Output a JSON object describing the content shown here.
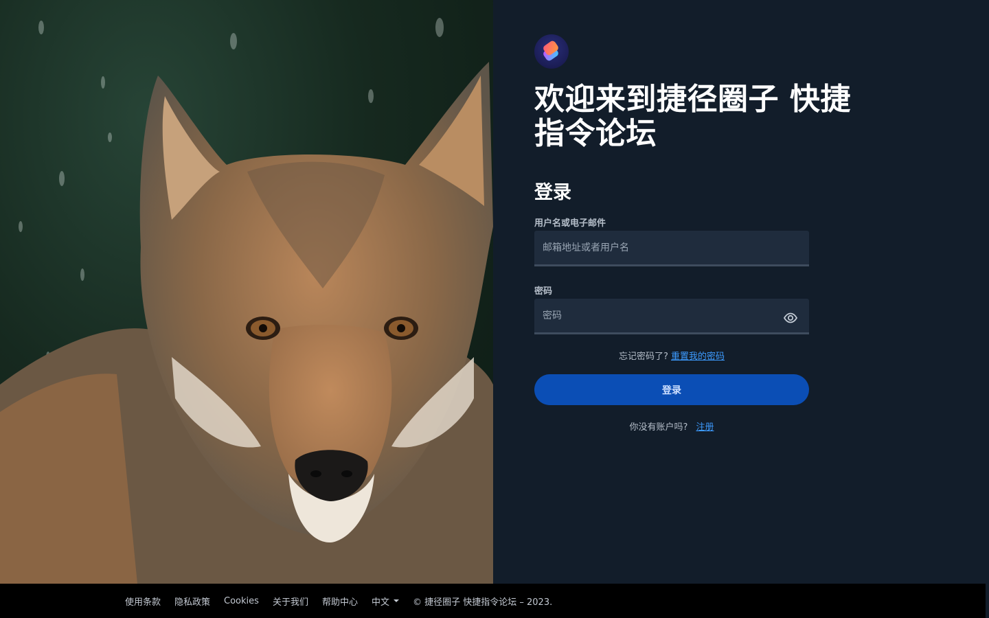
{
  "hero": {
    "image": "wolf-portrait-in-snow"
  },
  "brand": {
    "logo_icon": "shortcuts-logo-icon"
  },
  "headline": "欢迎来到捷径圈子 快捷指令论坛",
  "login": {
    "title": "登录",
    "username_label": "用户名或电子邮件",
    "username_placeholder": "邮箱地址或者用户名",
    "password_label": "密码",
    "password_placeholder": "密码",
    "show_password_icon": "eye-icon",
    "forgot_text": "忘记密码了?",
    "reset_link": "重置我的密码",
    "submit_label": "登录",
    "no_account_text": "你没有账户吗?",
    "register_link": "注册"
  },
  "footer": {
    "links": [
      "使用条款",
      "隐私政策",
      "Cookies",
      "关于我们",
      "帮助中心"
    ],
    "language": "中文",
    "copyright": "© 捷径圈子 快捷指令论坛 – 2023."
  },
  "colors": {
    "panel_bg": "#121d2a",
    "input_bg": "#1f2c3d",
    "button_bg": "#0b4eb5",
    "link": "#3d9bff",
    "footer_bg": "#000000"
  }
}
